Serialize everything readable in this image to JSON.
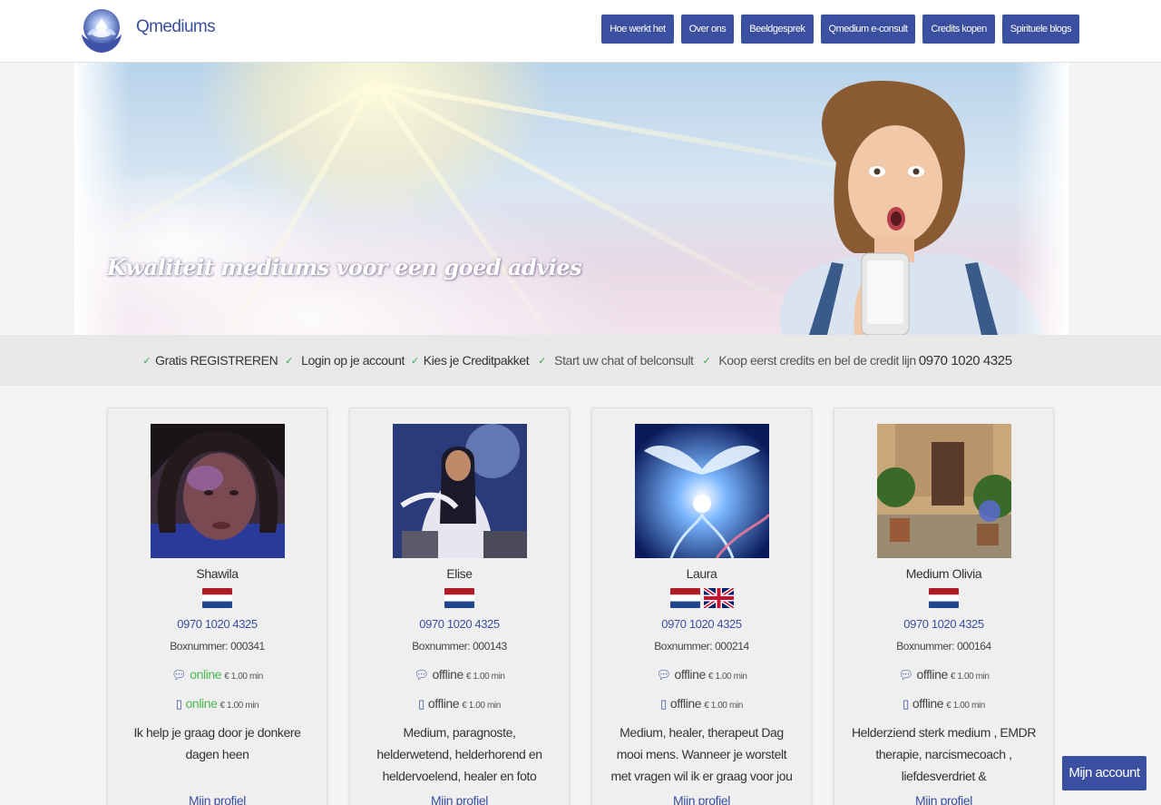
{
  "brand": {
    "name": "Qmediums",
    "logo_icon": "lotus-hands-logo"
  },
  "nav": [
    {
      "label": "Hoe werkt het"
    },
    {
      "label": "Over ons"
    },
    {
      "label": "Beeldgesprek"
    },
    {
      "label": "Qmedium e-consult"
    },
    {
      "label": "Credits kopen"
    },
    {
      "label": "Spirituele blogs"
    }
  ],
  "hero": {
    "title": "Kwaliteit mediums voor een goed advies"
  },
  "steps": [
    {
      "label": "Gratis REGISTREREN"
    },
    {
      "label": "Login op je account"
    },
    {
      "label": "Kies je Creditpakket"
    },
    {
      "label": "Start uw chat of belconsult"
    },
    {
      "label": "Koop eerst credits en bel de credit lijn",
      "phone": "0970 1020 4325"
    }
  ],
  "mediums": [
    {
      "name": "Shawila",
      "flags": [
        "nl"
      ],
      "phone": "0970 1020 4325",
      "box": "Boxnummer: 000341",
      "chat_status": "online",
      "chat_price": "€ 1.00 min",
      "call_status": "online",
      "call_price": "€ 1.00 min",
      "description": "Ik help je graag door je donkere dagen heen",
      "profile_link": "Mijn profiel"
    },
    {
      "name": "Elise",
      "flags": [
        "nl"
      ],
      "phone": "0970 1020 4325",
      "box": "Boxnummer: 000143",
      "chat_status": "offline",
      "chat_price": "€ 1.00 min",
      "call_status": "offline",
      "call_price": "€ 1.00 min",
      "description": "Medium, paragnoste, helderwetend, helderhorend en heldervoelend, healer en foto lezen.",
      "profile_link": "Mijn profiel"
    },
    {
      "name": "Laura",
      "flags": [
        "nl",
        "uk"
      ],
      "phone": "0970 1020 4325",
      "box": "Boxnummer: 000214",
      "chat_status": "offline",
      "chat_price": "€ 1.00 min",
      "call_status": "offline",
      "call_price": "€ 1.00 min",
      "description": "Medium, healer, therapeut Dag mooi mens. Wanneer je worstelt met vragen wil ik er graag voor jou zijn met mijn",
      "profile_link": "Mijn profiel"
    },
    {
      "name": "Medium Olivia",
      "flags": [
        "nl"
      ],
      "phone": "0970 1020 4325",
      "box": "Boxnummer: 000164",
      "chat_status": "offline",
      "chat_price": "€ 1.00 min",
      "call_status": "offline",
      "call_price": "€ 1.00 min",
      "description": "Helderziend sterk medium , EMDR therapie, narcismecoach , liefdesverdriet & ontrouw/scheiding,",
      "profile_link": "Mijn profiel"
    }
  ],
  "account_button": "Mijn account",
  "colors": {
    "accent": "#3b4fa0",
    "online": "#4bb84e",
    "check": "#3aa655"
  }
}
